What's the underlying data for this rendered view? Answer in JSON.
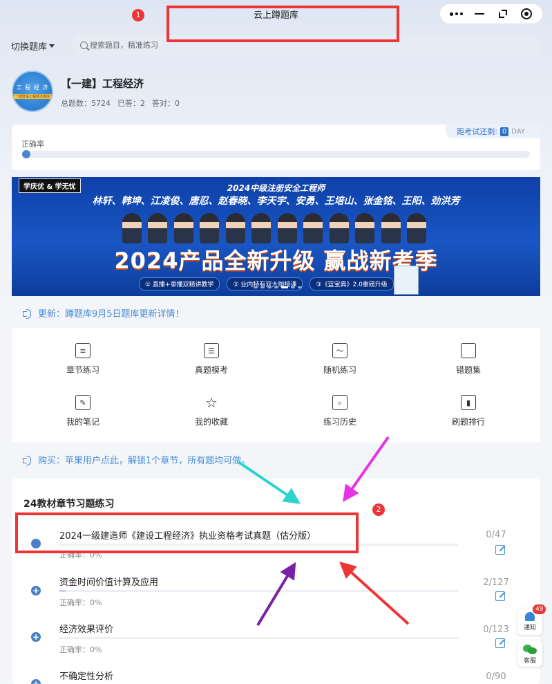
{
  "header": {
    "title": "云上蹲题库"
  },
  "search": {
    "switch_label": "切换题库",
    "placeholder": "搜索题目，精准练习"
  },
  "bank": {
    "avatar_title": "工 程 经 济",
    "avatar_sub": "一建建设工程经济题库",
    "name": "【一建】工程经济",
    "total": "总题数：5724",
    "answered": "已答：2",
    "correct": "答对：0"
  },
  "accuracy": {
    "countdown_label": "距考试还剩:",
    "countdown_value": "0",
    "countdown_unit": "DAY",
    "label": "正确率"
  },
  "banner": {
    "badge": "学庆优 & 学无忧",
    "headline": "2024中级注册安全工程师",
    "names": "林轩、韩坤、江凌俊、唐忍、赵春晓、李天宇、安勇、王培山、张金铭、王阳、劲洪芳",
    "slogan": "2024产品全新升级 赢战新考季",
    "features": [
      "① 直播+录播双精讲教学",
      "② 业内特有双大咖授课",
      "③《蓝宝典》2.0重磅升级"
    ]
  },
  "notices": {
    "update": "更新：蹲题库9月5日题库更新详情！",
    "purchase": "购买：苹果用户点此，解锁1个章节，所有题均可做。"
  },
  "menu": {
    "items": [
      {
        "label": "章节练习",
        "icon": "document-list-icon"
      },
      {
        "label": "真题模考",
        "icon": "clipboard-icon"
      },
      {
        "label": "随机练习",
        "icon": "chart-line-icon"
      },
      {
        "label": "错题集",
        "icon": "book-icon"
      },
      {
        "label": "我的笔记",
        "icon": "edit-note-icon"
      },
      {
        "label": "我的收藏",
        "icon": "star-icon"
      },
      {
        "label": "练习历史",
        "icon": "history-search-icon"
      },
      {
        "label": "刷题排行",
        "icon": "bar-chart-icon"
      }
    ]
  },
  "chapters": {
    "title": "24教材章节习题练习",
    "rows": [
      {
        "title": "2024一级建造师《建设工程经济》执业资格考试真题（估分版）",
        "accuracy": "正确率：0%",
        "count": "0/47",
        "progress": 0
      },
      {
        "title": "资金时间价值计算及应用",
        "accuracy": "正确率：0%",
        "count": "2/127",
        "progress": 0.016
      },
      {
        "title": "经济效果评价",
        "accuracy": "正确率：0%",
        "count": "0/123",
        "progress": 0
      },
      {
        "title": "不确定性分析",
        "accuracy": "",
        "count": "0/90",
        "progress": 0
      }
    ]
  },
  "floating": {
    "notify_label": "通知",
    "notify_badge": "49",
    "service_label": "客服"
  },
  "annotations": {
    "box1_number": "1",
    "box2_number": "2"
  },
  "colors": {
    "accent": "#4a8ed6",
    "annotation_red": "#ee3535",
    "arrow_cyan": "#2ed3d0",
    "arrow_magenta": "#e633e6",
    "arrow_purple": "#7a1fa6"
  }
}
